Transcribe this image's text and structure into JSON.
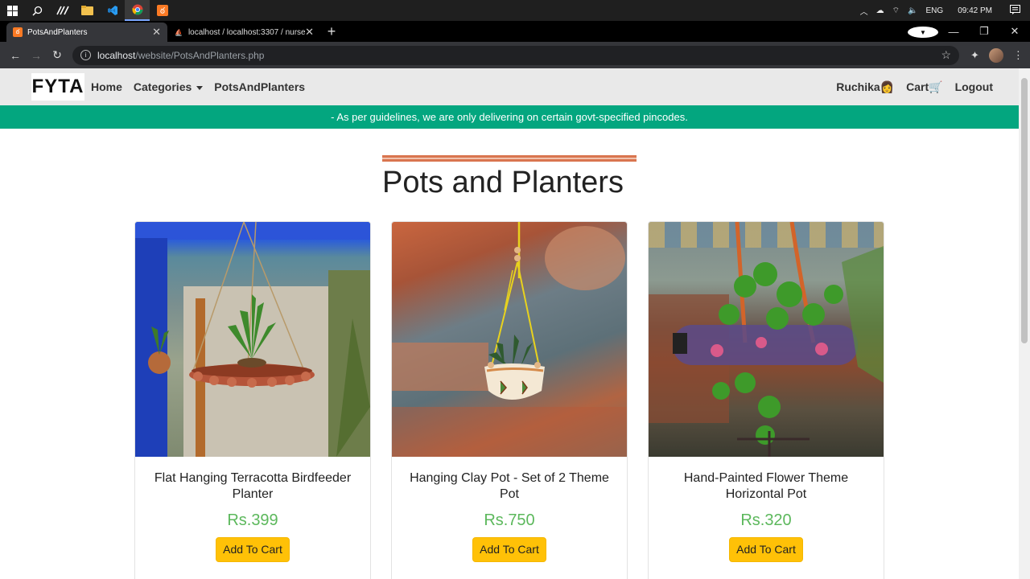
{
  "taskbar": {
    "lang": "ENG",
    "time": "09:42 PM"
  },
  "browser": {
    "tabs": [
      {
        "title": "PotsAndPlanters",
        "active": true
      },
      {
        "title": "localhost / localhost:3307 / nurse",
        "active": false
      }
    ],
    "url_host": "localhost",
    "url_path": "/website/PotsAndPlanters.php"
  },
  "site": {
    "logo_text_1": "F",
    "logo_text_2": "Y",
    "logo_text_3": "TA",
    "nav": {
      "home": "Home",
      "categories": "Categories",
      "current": "PotsAndPlanters",
      "user": "Ruchika",
      "cart": "Cart",
      "logout": "Logout"
    },
    "banner": "- As per guidelines, we are only delivering on certain govt-specified pincodes.",
    "heading": "Pots and Planters",
    "products": [
      {
        "title": "Flat Hanging Terracotta Birdfeeder Planter",
        "price": "Rs.399",
        "button": "Add To Cart"
      },
      {
        "title": "Hanging Clay Pot - Set of 2 Theme Pot",
        "price": "Rs.750",
        "button": "Add To Cart"
      },
      {
        "title": "Hand-Painted Flower Theme Horizontal Pot",
        "price": "Rs.320",
        "button": "Add To Cart"
      }
    ]
  },
  "colors": {
    "banner": "#03a67f",
    "price": "#5cb85c",
    "button": "#ffc107",
    "heading_bar": "#d9754f"
  }
}
